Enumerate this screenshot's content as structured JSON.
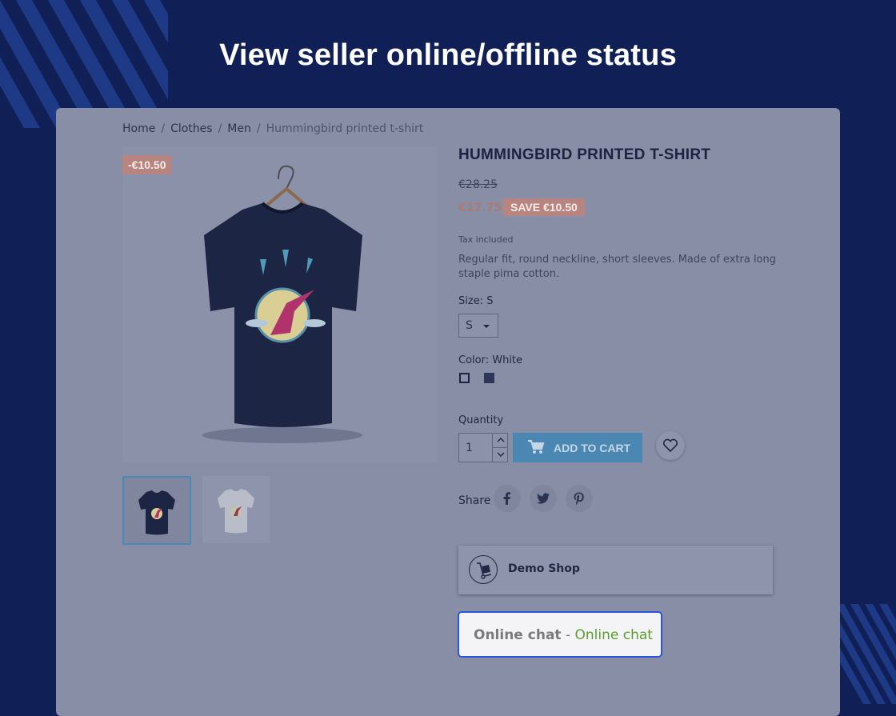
{
  "heading": "View seller online/offline status",
  "breadcrumb": {
    "items": [
      "Home",
      "Clothes",
      "Men"
    ],
    "current": "Hummingbird printed t-shirt",
    "separator": "/"
  },
  "product": {
    "title": "HUMMINGBIRD PRINTED T-SHIRT",
    "discount_flag": "-€10.50",
    "old_price": "€28.25",
    "new_price": "€17.75",
    "save_badge": "SAVE €10.50",
    "tax_note": "Tax included",
    "description": "Regular fit, round neckline, short sleeves. Made of extra long staple pima cotton.",
    "size_label": "Size: S",
    "size_value": "S",
    "color_label": "Color: White",
    "colors": [
      "#8a91a9",
      "#2b3658"
    ],
    "quantity_label": "Quantity",
    "quantity_value": "1",
    "add_to_cart": "ADD TO CART"
  },
  "share": {
    "label": "Share",
    "icons": [
      "facebook-icon",
      "twitter-icon",
      "pinterest-icon"
    ]
  },
  "seller": {
    "name": "Demo Shop"
  },
  "chat": {
    "label": "Online chat",
    "separator": " - ",
    "status": "Online chat",
    "status_color": "#5a9e2e",
    "border_color": "#2d52dc"
  },
  "colors": {
    "background": "#101f55",
    "overlay_panel": "#878ea6",
    "accent_button": "#4a87b3",
    "discount": "#b7847f"
  }
}
